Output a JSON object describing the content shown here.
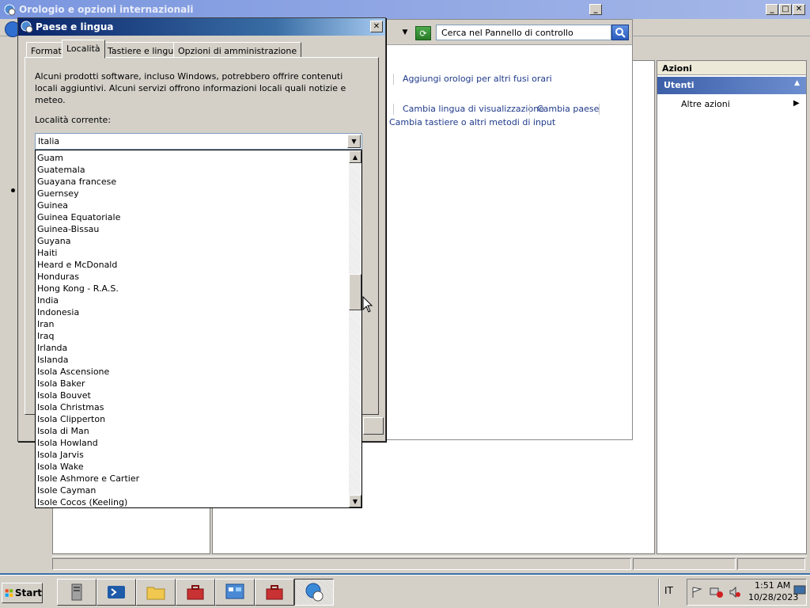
{
  "mmc": {
    "title": "Orologio e opzioni internazionali",
    "actions_header": "Azioni",
    "actions_section": "Utenti",
    "actions_item": "Altre azioni"
  },
  "control_panel": {
    "search_placeholder": "Cerca nel Pannello di controllo",
    "link_add_clocks": "Aggiungi orologi per altri fusi orari",
    "link_display_language": "Cambia lingua di visualizzazione",
    "link_change_country": "Cambia paese",
    "link_keyboards": "Cambia tastiere o altri metodi di input"
  },
  "dialog": {
    "title": "Paese e lingua",
    "tabs": [
      "Formati",
      "Località",
      "Tastiere e lingue",
      "Opzioni di amministrazione"
    ],
    "active_tab": "Località",
    "description": "Alcuni prodotti software, incluso Windows, potrebbero offrire contenuti locali aggiuntivi. Alcuni servizi offrono informazioni locali quali notizie e meteo.",
    "current_location_label": "Località corrente:",
    "current_location_value": "Italia",
    "location_options": [
      "Guam",
      "Guatemala",
      "Guayana francese",
      "Guernsey",
      "Guinea",
      "Guinea Equatoriale",
      "Guinea-Bissau",
      "Guyana",
      "Haiti",
      "Heard e McDonald",
      "Honduras",
      "Hong Kong - R.A.S.",
      "India",
      "Indonesia",
      "Iran",
      "Iraq",
      "Irlanda",
      "Islanda",
      "Isola Ascensione",
      "Isola Baker",
      "Isola Bouvet",
      "Isola Christmas",
      "Isola Clipperton",
      "Isola di Man",
      "Isola Howland",
      "Isola Jarvis",
      "Isola Wake",
      "Isole Ashmore e Cartier",
      "Isole Cayman",
      "Isole Cocos (Keeling)"
    ]
  },
  "taskbar": {
    "start_label": "Start",
    "language": "IT",
    "time": "1:51 AM",
    "date": "10/28/2023",
    "apps": [
      "server-manager-icon",
      "powershell-icon",
      "file-explorer-icon",
      "toolbox-icon",
      "control-panel-icon",
      "toolbox-icon",
      "globe-clock-icon"
    ]
  },
  "colors": {
    "dialog_title": "#0a246a",
    "link": "#1f3a8a",
    "actions_section": "#3d5fa8",
    "desktop": "#3a6ea5"
  }
}
